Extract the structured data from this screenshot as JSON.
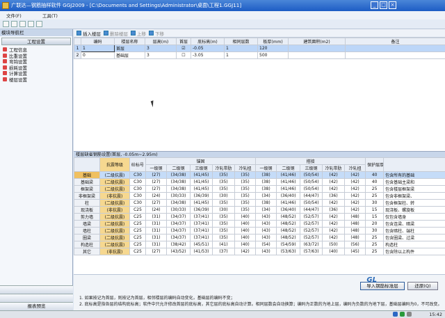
{
  "window": {
    "title": "广联达—钢筋抽样软件 GGJ2009 - [C:\\Documents and Settings\\Administrator\\桌面\\工程1.GGJ11]",
    "buttons": [
      "_",
      "□",
      "×"
    ]
  },
  "watermark": "优酷",
  "menu": [
    "文件(F)",
    "",
    "",
    "工具(T)",
    "",
    "",
    "",
    ""
  ],
  "sidebar": {
    "header": "模块导航栏",
    "section": "工程设置",
    "items": [
      "工程信息",
      "比重设置",
      "弯钩设置",
      "损耗设置",
      "计算设置",
      "楼层设置"
    ],
    "bottom": [
      "",
      "",
      "报表预览"
    ]
  },
  "floor_toolbar": {
    "insert": "插入楼层",
    "delete": "删除楼层",
    "up": "上移",
    "down": "下移"
  },
  "floor_table": {
    "headers": [
      "",
      "编码",
      "楼层名称",
      "层高(m)",
      "首层",
      "底标高(m)",
      "相同层数",
      "板厚(mm)",
      "建筑面积(m2)",
      "备注"
    ],
    "rows": [
      {
        "idx": "1",
        "code": "1",
        "name": "首层",
        "height": "3",
        "first": true,
        "bottom": "-0.05",
        "same": "1",
        "thick": "120",
        "area": "",
        "note": ""
      },
      {
        "idx": "2",
        "code": "0",
        "name": "基础层",
        "height": "3",
        "first": false,
        "bottom": "-3.05",
        "same": "1",
        "thick": "500",
        "area": "",
        "note": ""
      }
    ]
  },
  "rebar": {
    "title": "楼层缺省钢筋设置(首层, -0.05m~2.95m)",
    "headers": {
      "grade": "抗震等级",
      "concrete": "砼标号",
      "anchor": "锚固",
      "lap": "搭接",
      "cover": "保护层厚(mm)",
      "sub": [
        "一级钢",
        "二级钢",
        "三级钢",
        "冷轧带肋",
        "冷轧扭"
      ]
    },
    "rows": [
      {
        "name": "基础",
        "grade": "(二级抗震)",
        "c": "C30",
        "a": [
          "(27)",
          "(34/38)",
          "(41/45)",
          "(35)",
          "(35)"
        ],
        "l": [
          "(38)",
          "(41/46)",
          "(50/54)",
          "(42)",
          "(42)"
        ],
        "cover": "40",
        "note": "包含所有的基础"
      },
      {
        "name": "基础梁",
        "grade": "(二级抗震)",
        "c": "C30",
        "a": [
          "(27)",
          "(34/38)",
          "(41/45)",
          "(35)",
          "(35)"
        ],
        "l": [
          "(38)",
          "(41/46)",
          "(50/54)",
          "(42)",
          "(42)"
        ],
        "cover": "40",
        "note": "包含基础主梁和"
      },
      {
        "name": "框架梁",
        "grade": "(二级抗震)",
        "c": "C30",
        "a": [
          "(27)",
          "(34/38)",
          "(41/45)",
          "(35)",
          "(35)"
        ],
        "l": [
          "(38)",
          "(41/46)",
          "(50/54)",
          "(42)",
          "(42)"
        ],
        "cover": "25",
        "note": "包含楼层框架梁"
      },
      {
        "name": "非框架梁",
        "grade": "(非抗震)",
        "c": "C30",
        "a": [
          "(24)",
          "(30/33)",
          "(36/39)",
          "(30)",
          "(35)"
        ],
        "l": [
          "(34)",
          "(36/40)",
          "(44/47)",
          "(36)",
          "(42)"
        ],
        "cover": "25",
        "note": "包含非框架梁、"
      },
      {
        "name": "柱",
        "grade": "(二级抗震)",
        "c": "C30",
        "a": [
          "(27)",
          "(34/38)",
          "(41/45)",
          "(35)",
          "(35)"
        ],
        "l": [
          "(38)",
          "(41/46)",
          "(50/54)",
          "(42)",
          "(42)"
        ],
        "cover": "30",
        "note": "包含框架柱、转"
      },
      {
        "name": "现浇板",
        "grade": "(非抗震)",
        "c": "C25",
        "a": [
          "(24)",
          "(30/33)",
          "(36/39)",
          "(30)",
          "(35)"
        ],
        "l": [
          "(34)",
          "(36/40)",
          "(44/47)",
          "(36)",
          "(42)"
        ],
        "cover": "15",
        "note": "现浇板、螺旋板"
      },
      {
        "name": "剪力墙",
        "grade": "(二级抗震)",
        "c": "C25",
        "a": [
          "(31)",
          "(34/37)",
          "(37/41)",
          "(35)",
          "(40)"
        ],
        "l": [
          "(43)",
          "(48/52)",
          "(52/57)",
          "(42)",
          "(48)"
        ],
        "cover": "15",
        "note": "仅包含墙身"
      },
      {
        "name": "墙梁",
        "grade": "(二级抗震)",
        "c": "C25",
        "a": [
          "(31)",
          "(34/37)",
          "(37/41)",
          "(35)",
          "(40)"
        ],
        "l": [
          "(43)",
          "(48/52)",
          "(52/57)",
          "(42)",
          "(48)"
        ],
        "cover": "20",
        "note": "包含连梁、暗梁"
      },
      {
        "name": "墙柱",
        "grade": "(二级抗震)",
        "c": "C25",
        "a": [
          "(31)",
          "(34/37)",
          "(37/41)",
          "(35)",
          "(40)"
        ],
        "l": [
          "(43)",
          "(48/52)",
          "(52/57)",
          "(42)",
          "(48)"
        ],
        "cover": "30",
        "note": "包含暗柱、端柱"
      },
      {
        "name": "圈梁",
        "grade": "(二级抗震)",
        "c": "C25",
        "a": [
          "(31)",
          "(34/37)",
          "(37/41)",
          "(35)",
          "(40)"
        ],
        "l": [
          "(43)",
          "(48/52)",
          "(52/57)",
          "(42)",
          "(48)"
        ],
        "cover": "25",
        "note": "包含圈梁、过梁"
      },
      {
        "name": "构造柱",
        "grade": "(二级抗震)",
        "c": "C25",
        "a": [
          "(31)",
          "(38/42)",
          "(45/51)",
          "(41)",
          "(40)"
        ],
        "l": [
          "(54)",
          "(54/59)",
          "(63/72)",
          "(50)",
          "(56)"
        ],
        "cover": "25",
        "note": "构造柱"
      },
      {
        "name": "其它",
        "grade": "(非抗震)",
        "c": "C25",
        "a": [
          "(27)",
          "(43/52)",
          "(41/53)",
          "(37)",
          "(42)"
        ],
        "l": [
          "(43)",
          "(53/63)",
          "(57/63)",
          "(40)",
          "(45)"
        ],
        "cover": "25",
        "note": "包含除以上构件"
      }
    ]
  },
  "bottom": {
    "logo": "GL",
    "import_btn": "导入钢筋标准层",
    "restore_btn": "还原(Q)",
    "notes": [
      "1. 如果按记为首层，则按记为首层，相邻楼层的编码自动变化，基础层的编码不变；",
      "2. 底标高是指各层的结构底标高；软件中只允许修改首层的底标高，其它层的底标高自动计算。相同层数会自动换算；编码为正数的为地上层，编码为负数的为地下层，基础层编码为0，不可改变。"
    ]
  },
  "taskbar": {
    "clock": "15:42"
  }
}
